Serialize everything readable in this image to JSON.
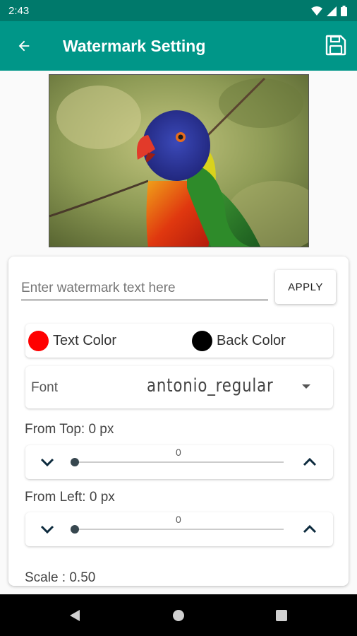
{
  "status_bar": {
    "time": "2:43",
    "icons": [
      "wifi-icon",
      "signal-icon",
      "battery-icon"
    ],
    "color": "#00796b"
  },
  "app_bar": {
    "title": "Watermark Setting",
    "back_icon": "arrow-back-icon",
    "save_icon": "save-icon",
    "color": "#009688"
  },
  "preview": {
    "description_icon": "parrot-photo"
  },
  "watermark": {
    "placeholder": "Enter watermark text here",
    "value": "",
    "apply_label": "APPLY"
  },
  "colors": {
    "text_color_label": "Text Color",
    "text_color_value": "#ff0000",
    "back_color_label": "Back Color",
    "back_color_value": "#000000"
  },
  "font": {
    "label": "Font",
    "selected": "antonio_regular"
  },
  "from_top": {
    "label": "From Top: 0 px",
    "value": "0",
    "fraction": 0.0
  },
  "from_left": {
    "label": "From Left: 0 px",
    "value": "0",
    "fraction": 0.0
  },
  "scale": {
    "label": "Scale : 0.50"
  },
  "nav_bar": {
    "icons": [
      "back-triangle-icon",
      "home-circle-icon",
      "recents-square-icon"
    ]
  }
}
